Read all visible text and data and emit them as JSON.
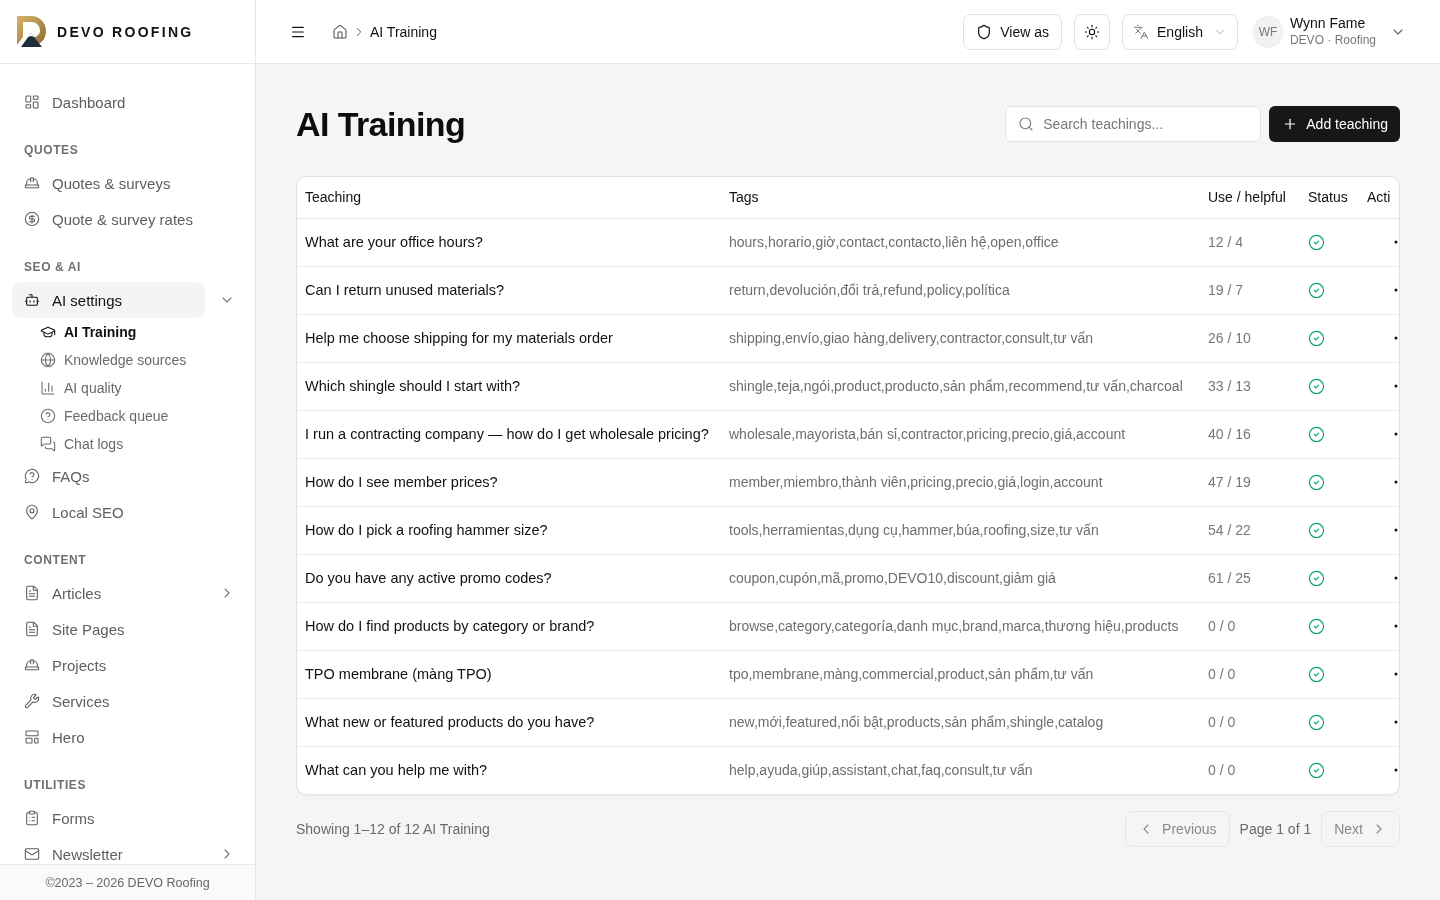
{
  "brand": {
    "name": "DEVO ROOFING"
  },
  "sidebar": {
    "sections": [
      {
        "items": [
          {
            "label": "Dashboard",
            "selected": false
          }
        ]
      },
      {
        "heading": "QUOTES",
        "items": [
          {
            "label": "Quotes & surveys",
            "selected": false
          },
          {
            "label": "Quote & survey rates",
            "selected": false
          }
        ]
      },
      {
        "heading": "SEO & AI",
        "items": [
          {
            "label": "AI settings",
            "selected": true,
            "expanded": true,
            "children": [
              {
                "label": "AI Training",
                "selected": true
              },
              {
                "label": "Knowledge sources",
                "selected": false
              },
              {
                "label": "AI quality",
                "selected": false
              },
              {
                "label": "Feedback queue",
                "selected": false
              },
              {
                "label": "Chat logs",
                "selected": false
              }
            ]
          },
          {
            "label": "FAQs",
            "selected": false
          },
          {
            "label": "Local SEO",
            "selected": false
          }
        ]
      },
      {
        "heading": "CONTENT",
        "items": [
          {
            "label": "Articles",
            "selected": false,
            "expanded": false
          },
          {
            "label": "Site Pages",
            "selected": false
          },
          {
            "label": "Projects",
            "selected": false
          },
          {
            "label": "Services",
            "selected": false
          },
          {
            "label": "Hero",
            "selected": false
          }
        ]
      },
      {
        "heading": "UTILITIES",
        "items": [
          {
            "label": "Forms",
            "selected": false
          },
          {
            "label": "Newsletter",
            "selected": false,
            "expanded": false
          }
        ]
      }
    ],
    "footer": "©2023 – 2026 DEVO Roofing"
  },
  "topbar": {
    "breadcrumb": {
      "current": "AI Training"
    },
    "view_as": "View as",
    "language": "English",
    "user": {
      "initials": "WF",
      "name": "Wynn Fame",
      "subtitle": "DEVO · Roofing"
    }
  },
  "page": {
    "title": "AI Training",
    "search": {
      "placeholder": "Search teachings..."
    },
    "add_button": "Add teaching"
  },
  "table": {
    "columns": [
      "Teaching",
      "Tags",
      "Use / helpful",
      "Status",
      "Acti"
    ],
    "rows": [
      {
        "teaching": "What are your office hours?",
        "tags": "hours,horario,giờ,contact,contacto,liên hệ,open,office",
        "use_helpful": "12 / 4",
        "active": true
      },
      {
        "teaching": "Can I return unused materials?",
        "tags": "return,devolución,đổi trả,refund,policy,política",
        "use_helpful": "19 / 7",
        "active": true
      },
      {
        "teaching": "Help me choose shipping for my materials order",
        "tags": "shipping,envío,giao hàng,delivery,contractor,consult,tư vấn",
        "use_helpful": "26 / 10",
        "active": true
      },
      {
        "teaching": "Which shingle should I start with?",
        "tags": "shingle,teja,ngói,product,producto,sản phẩm,recommend,tư vấn,charcoal",
        "use_helpful": "33 / 13",
        "active": true
      },
      {
        "teaching": "I run a contracting company — how do I get wholesale pricing?",
        "tags": "wholesale,mayorista,bán sỉ,contractor,pricing,precio,giá,account",
        "use_helpful": "40 / 16",
        "active": true
      },
      {
        "teaching": "How do I see member prices?",
        "tags": "member,miembro,thành viên,pricing,precio,giá,login,account",
        "use_helpful": "47 / 19",
        "active": true
      },
      {
        "teaching": "How do I pick a roofing hammer size?",
        "tags": "tools,herramientas,dụng cụ,hammer,búa,roofing,size,tư vấn",
        "use_helpful": "54 / 22",
        "active": true
      },
      {
        "teaching": "Do you have any active promo codes?",
        "tags": "coupon,cupón,mã,promo,DEVO10,discount,giảm giá",
        "use_helpful": "61 / 25",
        "active": true
      },
      {
        "teaching": "How do I find products by category or brand?",
        "tags": "browse,category,categoría,danh mục,brand,marca,thương hiệu,products",
        "use_helpful": "0 / 0",
        "active": true
      },
      {
        "teaching": "TPO membrane (màng TPO)",
        "tags": "tpo,membrane,màng,commercial,product,sản phẩm,tư vấn",
        "use_helpful": "0 / 0",
        "active": true
      },
      {
        "teaching": "What new or featured products do you have?",
        "tags": "new,mới,featured,nổi bật,products,sản phẩm,shingle,catalog",
        "use_helpful": "0 / 0",
        "active": true
      },
      {
        "teaching": "What can you help me with?",
        "tags": "help,ayuda,giúp,assistant,chat,faq,consult,tư vấn",
        "use_helpful": "0 / 0",
        "active": true
      }
    ]
  },
  "pagination": {
    "summary": "Showing 1–12 of 12 AI Training",
    "previous": {
      "label": "Previous",
      "disabled": true
    },
    "page": "Page 1 of 1",
    "next": {
      "label": "Next",
      "disabled": true
    }
  }
}
